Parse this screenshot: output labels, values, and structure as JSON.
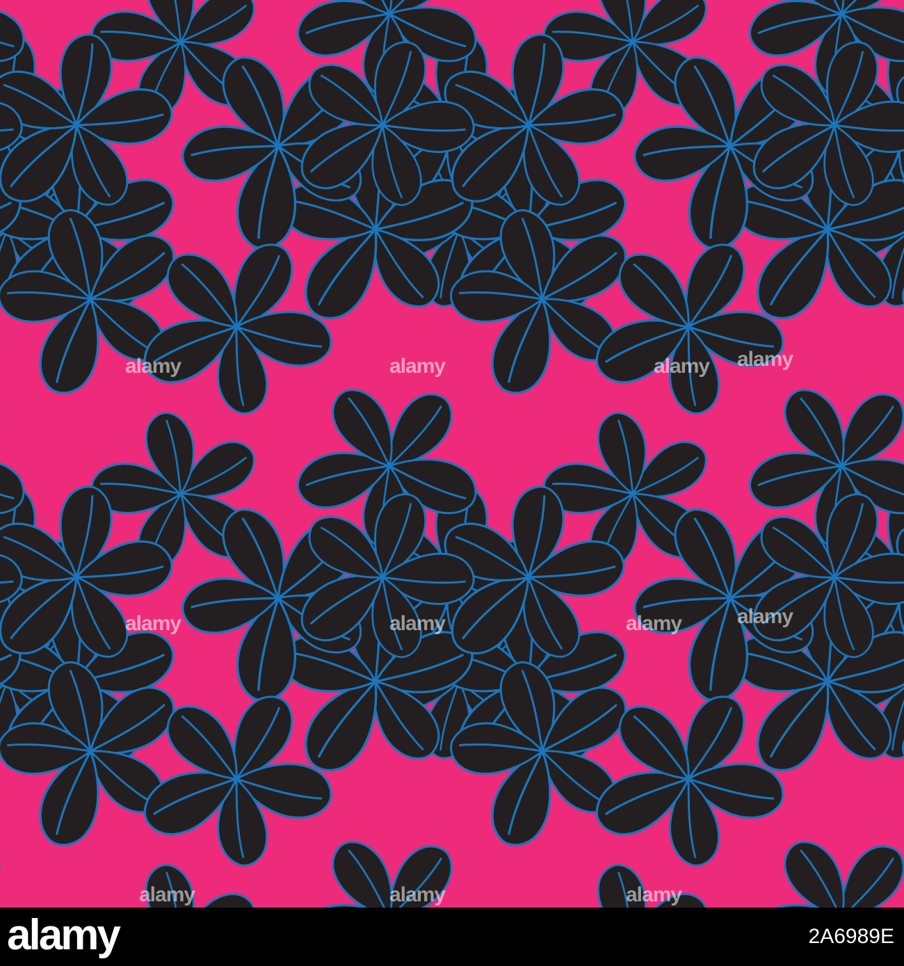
{
  "image": {
    "description_colors": {
      "background": "#EE2A7B",
      "petal_fill": "#231F20",
      "petal_outline": "#1B75BC"
    }
  },
  "watermark": {
    "text": "alamy"
  },
  "footer": {
    "logo": "alamy",
    "image_id": "2A6989E"
  }
}
